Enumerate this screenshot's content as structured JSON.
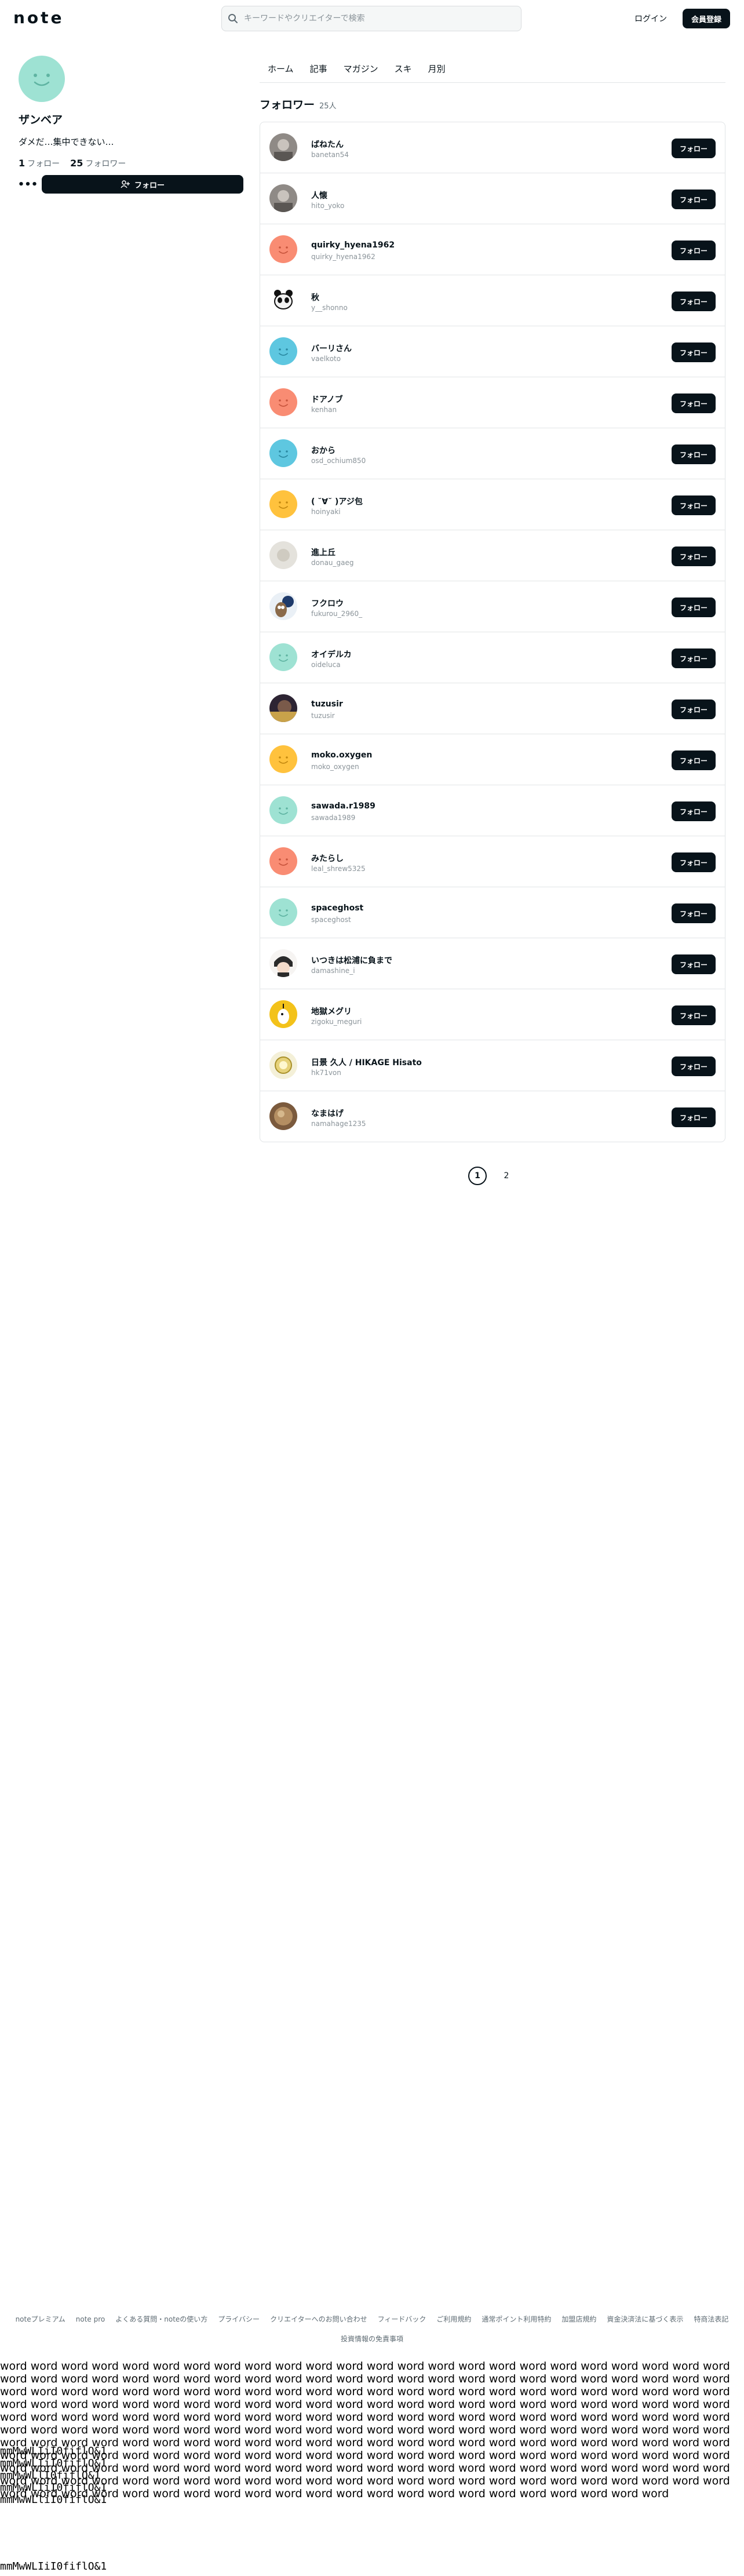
{
  "header": {
    "logo": "note",
    "search_placeholder": "キーワードやクリエイターで検索",
    "login_label": "ログイン",
    "signup_label": "会員登録"
  },
  "profile": {
    "name": "ザンベア",
    "bio": "ダメだ…集中できない…",
    "following_count": "1",
    "following_label": "フォロー",
    "followers_count": "25",
    "followers_label": "フォロワー",
    "more_label": "•••",
    "follow_label": "フォロー",
    "avatar_color": "#9ee2d3"
  },
  "tabs": [
    "ホーム",
    "記事",
    "マガジン",
    "スキ",
    "月別"
  ],
  "followers_section": {
    "title": "フォロワー",
    "count": "25人"
  },
  "follow_button_label": "フォロー",
  "followers": [
    {
      "name": "ばねたん",
      "id": "banetan54"
    },
    {
      "name": "人懐",
      "id": "hito_yoko"
    },
    {
      "name": "quirky_hyena1962",
      "id": "quirky_hyena1962"
    },
    {
      "name": "秋",
      "id": "y__shonno"
    },
    {
      "name": "バーリさん",
      "id": "vaelkoto"
    },
    {
      "name": "ドアノブ",
      "id": "kenhan"
    },
    {
      "name": "おから",
      "id": "osd_ochium850"
    },
    {
      "name": "( ˘∀˘ )アジ包",
      "id": "hoinyaki"
    },
    {
      "name": "進上丘",
      "id": "donau_gaeg"
    },
    {
      "name": "フクロウ",
      "id": "fukurou_2960_"
    },
    {
      "name": "オイデルカ",
      "id": "oideluca"
    },
    {
      "name": "tuzusir",
      "id": "tuzusir"
    },
    {
      "name": "moko.oxygen",
      "id": "moko_oxygen"
    },
    {
      "name": "sawada.r1989",
      "id": "sawada1989"
    },
    {
      "name": "みたらし",
      "id": "leal_shrew5325"
    },
    {
      "name": "spaceghost",
      "id": "spaceghost"
    },
    {
      "name": "いつきは松浦に負まで",
      "id": "damashine_i"
    },
    {
      "name": "地獄メグリ",
      "id": "zigoku_meguri"
    },
    {
      "name": "日景 久人 / HIKAGE Hisato",
      "id": "hk71von"
    },
    {
      "name": "なまはげ",
      "id": "namahage1235"
    }
  ],
  "avatar_styles": [
    "photo-gray",
    "photo-gray",
    "smiley-coral",
    "panda",
    "smiley-blue",
    "smiley-coral",
    "smiley-blue",
    "smiley-yellow",
    "photo-light",
    "owl",
    "smiley-mint",
    "photo-dark",
    "smiley-yellow",
    "smiley-mint",
    "smiley-coral",
    "smiley-mint",
    "anime",
    "yellow-drop",
    "badge",
    "photo-brown"
  ],
  "colors": {
    "mint": "#9ee2d3",
    "coral": "#f98c73",
    "blue": "#5ec7e0",
    "yellow": "#ffc23d",
    "dark": "#08131a"
  },
  "pagination": [
    "1",
    "2"
  ],
  "footer": {
    "links": [
      "noteプレミアム",
      "note pro",
      "よくある質問・noteの使い方",
      "プライバシー",
      "クリエイターへのお問い合わせ",
      "フィードバック",
      "ご利用規約",
      "通常ポイント利用特約",
      "加盟店規約",
      "資金決済法に基づく表示",
      "特商法表記"
    ],
    "links2": [
      "投資情報の免責事項"
    ]
  },
  "filler_words": "word word word word word word word word word word word word word word word word word word word word word word word word word word word word word word word word word word word word word word word word word word word word word word word word word word word word word word word word word word word word word word word word word word word word word word word word word word word word word word word word word word word word word word word word word word word word word word word word word word word word word word word word word word word word word word word word word word word word word word word word word word word word word word word word word word word word word word word word word word word word word word word word word word word word word word word word word word word word word word word word word word word word word word word word word word word word word word word word word word word word word word word word word word word word word word word word word word word word word word word word word word word word word word word word word word word word word word word word word word word word word word word word word word word word word word word word word word word word word word word word word word word word word word word word word word word word word word word word word word word word word word",
  "glyph_lines": [
    "mmMwWLIiI0fiflO&1",
    "mmMwWLIiI0fiflO&1",
    "mmMwWLlI0fiflO&1",
    "mmMwWLIiI0fiflO&1",
    "mmMwWLliI0fiflO&1"
  ],
  "glyph_last": "mmMwWLIiI0fiflO&1"
}
